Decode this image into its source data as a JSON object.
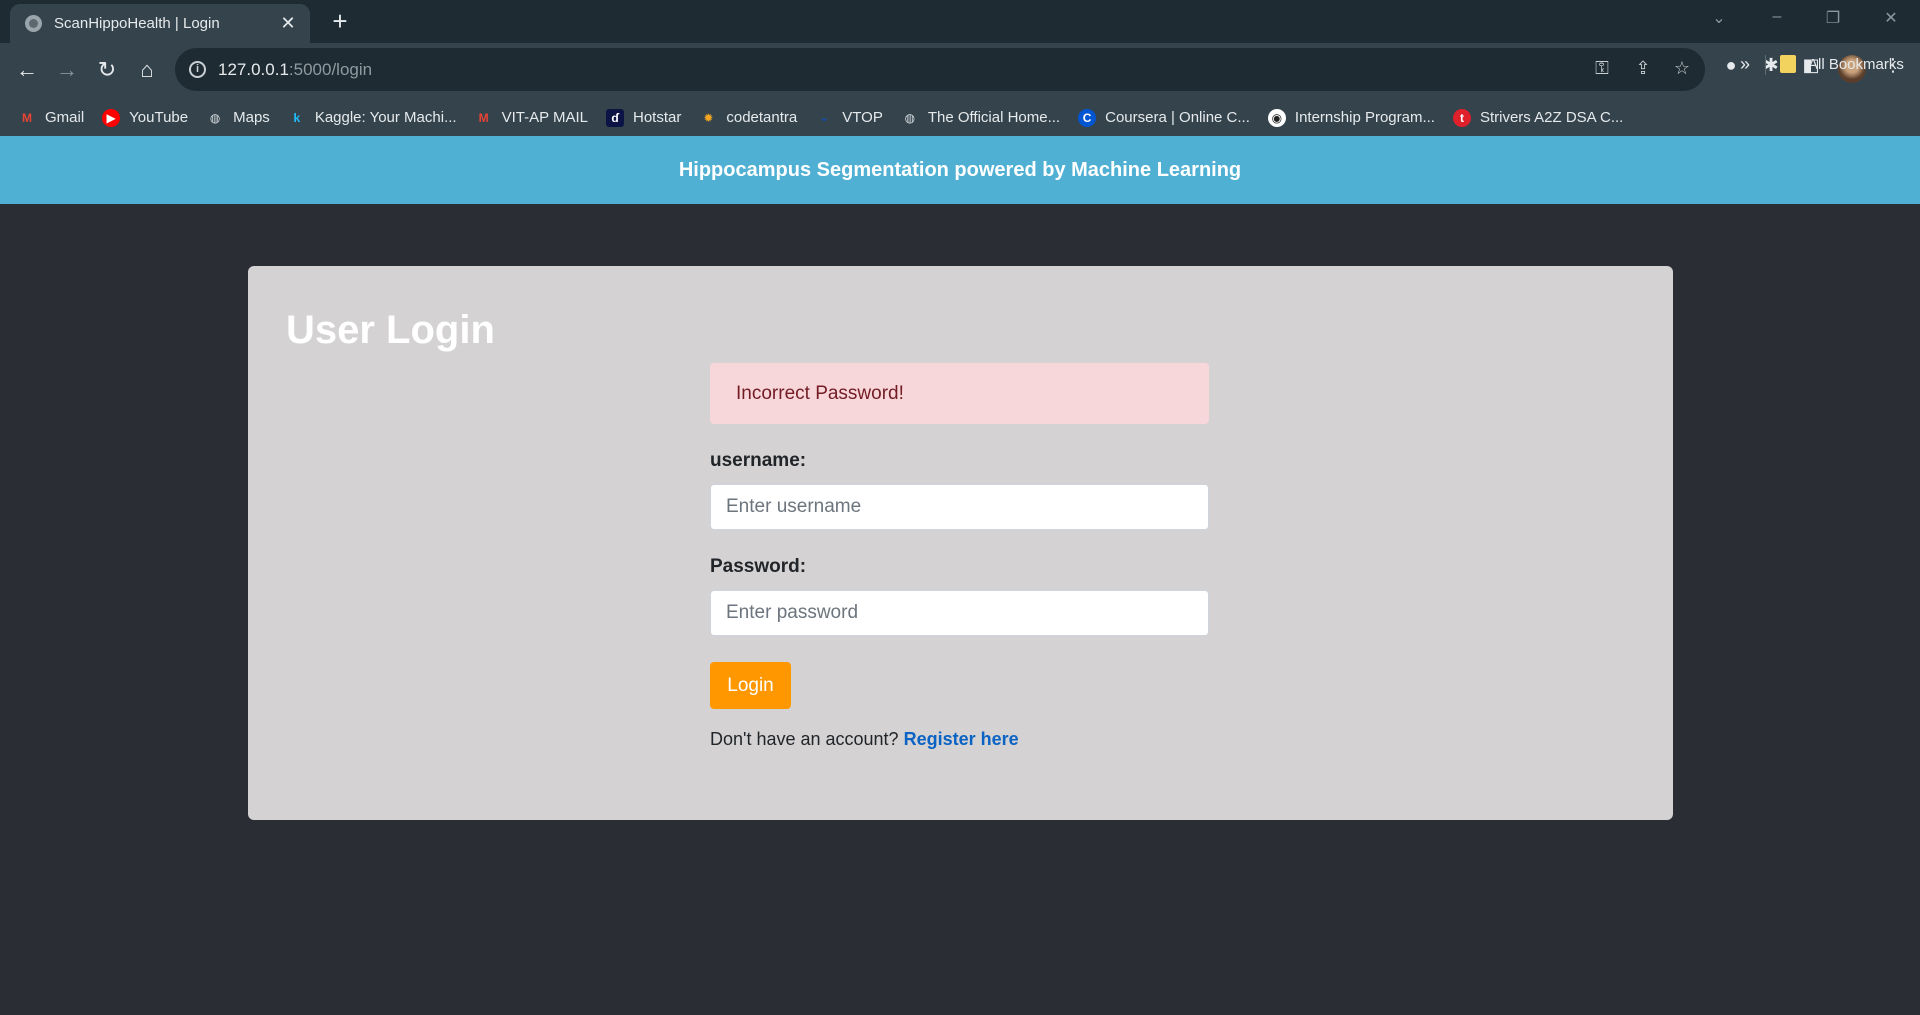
{
  "browser": {
    "tab_title": "ScanHippoHealth | Login",
    "url_host": "127.0.0.1",
    "url_rest": ":5000/login",
    "bookmarks": [
      {
        "label": "Gmail",
        "icon": "gmail-icon",
        "color": "#ea4335"
      },
      {
        "label": "YouTube",
        "icon": "youtube-icon",
        "color": "#ff0000"
      },
      {
        "label": "Maps",
        "icon": "globe-icon",
        "color": "#d7dde0"
      },
      {
        "label": "Kaggle: Your Machi...",
        "icon": "kaggle-icon",
        "color": "#20beff"
      },
      {
        "label": "VIT-AP MAIL",
        "icon": "gmail-icon",
        "color": "#ea4335"
      },
      {
        "label": "Hotstar",
        "icon": "hotstar-icon",
        "color": "#0c1445"
      },
      {
        "label": "codetantra",
        "icon": "codetantra-icon",
        "color": "#f5a623"
      },
      {
        "label": "VTOP",
        "icon": "vtop-icon",
        "color": "#1a4c9c"
      },
      {
        "label": "The Official Home...",
        "icon": "globe-icon",
        "color": "#d7dde0"
      },
      {
        "label": "Coursera | Online C...",
        "icon": "coursera-icon",
        "color": "#0056d2"
      },
      {
        "label": "Internship Program...",
        "icon": "internship-icon",
        "color": "#222222"
      },
      {
        "label": "Strivers A2Z DSA C...",
        "icon": "tuf-icon",
        "color": "#e0202a"
      }
    ],
    "all_bookmarks": "All Bookmarks"
  },
  "header": {
    "title": "Hippocampus Segmentation powered by Machine Learning"
  },
  "login": {
    "title": "User Login",
    "alert": "Incorrect Password!",
    "username_label": "username:",
    "username_placeholder": "Enter username",
    "password_label": "Password:",
    "password_placeholder": "Enter password",
    "button": "Login",
    "register_prompt": "Don't have an account?",
    "register_link": "Register here"
  },
  "colors": {
    "header_bg": "#4fb0d3",
    "card_bg": "#d4d2d3",
    "page_bg": "#2a2d33",
    "button_bg": "#ff9800",
    "alert_bg": "#f8d7da",
    "alert_text": "#721c24",
    "link": "#0b63c4"
  }
}
